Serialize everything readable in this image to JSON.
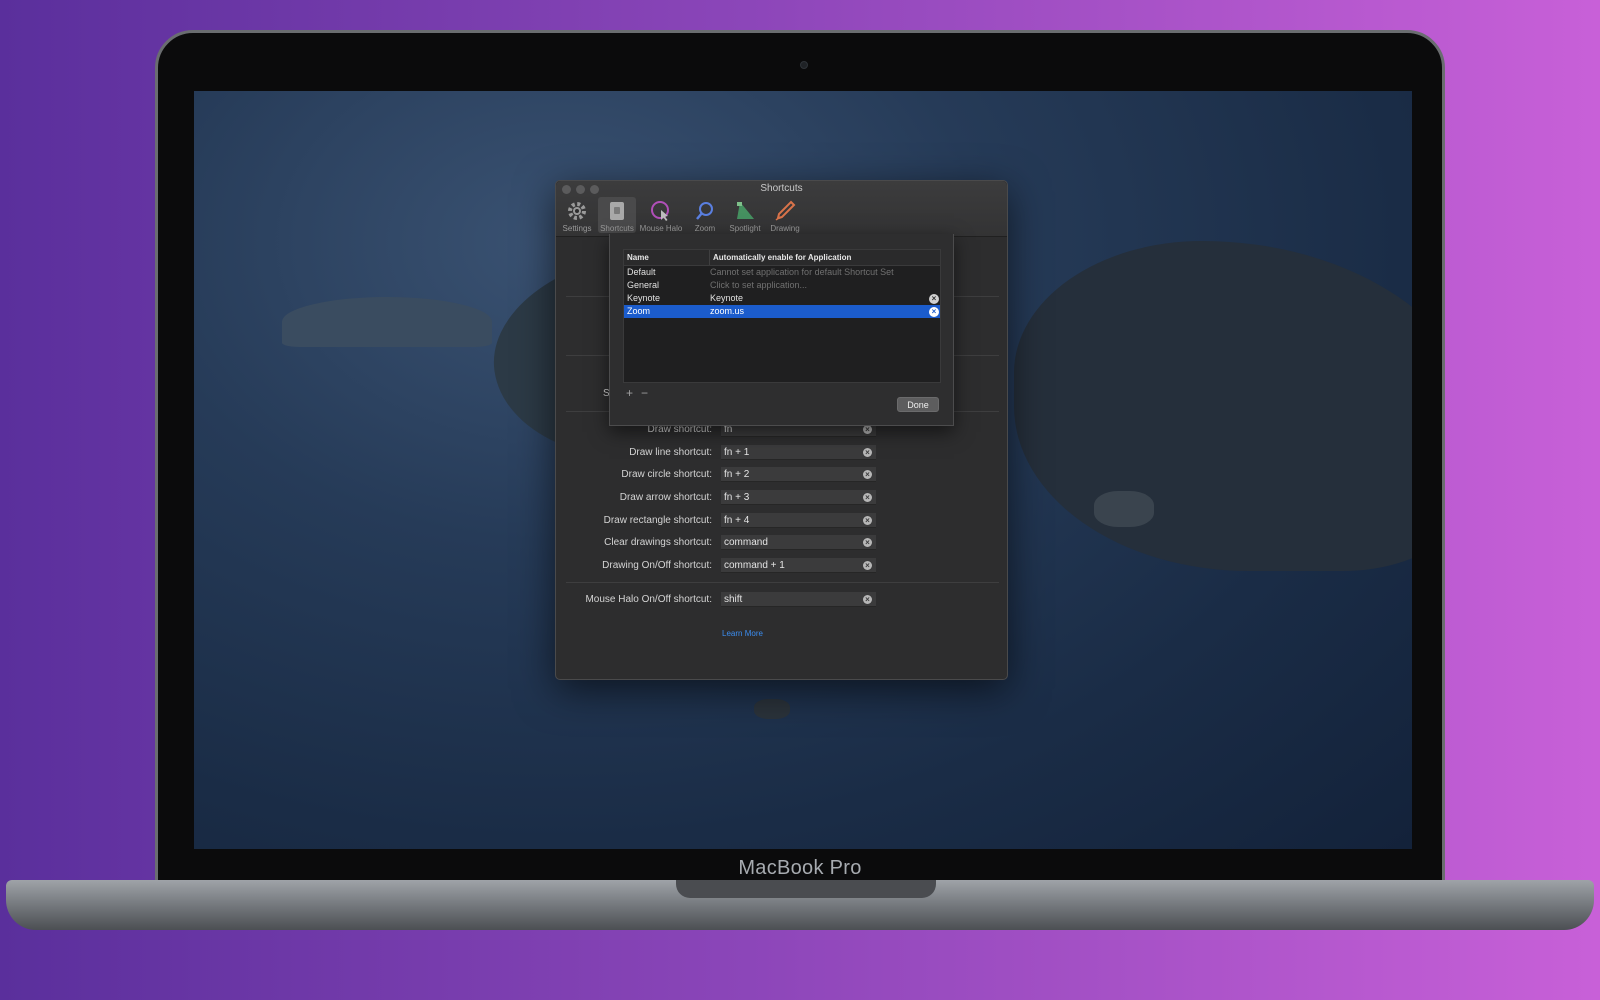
{
  "device": {
    "label": "MacBook Pro"
  },
  "window": {
    "title": "Shortcuts",
    "toolbar": [
      {
        "label": "Settings",
        "icon": "gear-icon"
      },
      {
        "label": "Shortcuts",
        "icon": "keyboard-icon",
        "active": true
      },
      {
        "label": "Mouse Halo",
        "icon": "mouse-halo-icon"
      },
      {
        "label": "Zoom",
        "icon": "magnifier-icon"
      },
      {
        "label": "Spotlight",
        "icon": "spotlight-icon"
      },
      {
        "label": "Drawing",
        "icon": "pencil-icon"
      }
    ],
    "partial_label": "S",
    "shortcuts": [
      {
        "label": "Draw shortcut:",
        "value": "fn"
      },
      {
        "label": "Draw line shortcut:",
        "value": "fn + 1"
      },
      {
        "label": "Draw circle shortcut:",
        "value": "fn + 2"
      },
      {
        "label": "Draw arrow shortcut:",
        "value": "fn + 3"
      },
      {
        "label": "Draw rectangle shortcut:",
        "value": "fn + 4"
      },
      {
        "label": "Clear drawings shortcut:",
        "value": "command"
      },
      {
        "label": "Drawing On/Off shortcut:",
        "value": "command + 1"
      },
      {
        "label": "Mouse Halo On/Off shortcut:",
        "value": "shift"
      }
    ],
    "learn_more": "Learn More"
  },
  "sheet": {
    "columns": {
      "name": "Name",
      "app": "Automatically enable for Application"
    },
    "rows": [
      {
        "name": "Default",
        "app": "Cannot set application for default Shortcut Set",
        "placeholder": true,
        "removable": false
      },
      {
        "name": "General",
        "app": "Click to set application...",
        "placeholder": true,
        "removable": false
      },
      {
        "name": "Keynote",
        "app": "Keynote",
        "placeholder": false,
        "removable": true
      },
      {
        "name": "Zoom",
        "app": "zoom.us",
        "placeholder": false,
        "removable": true,
        "selected": true
      }
    ],
    "add": "+",
    "remove": "−",
    "done": "Done"
  },
  "colors": {
    "selection": "#1b5ccc",
    "link": "#3b8df0"
  }
}
